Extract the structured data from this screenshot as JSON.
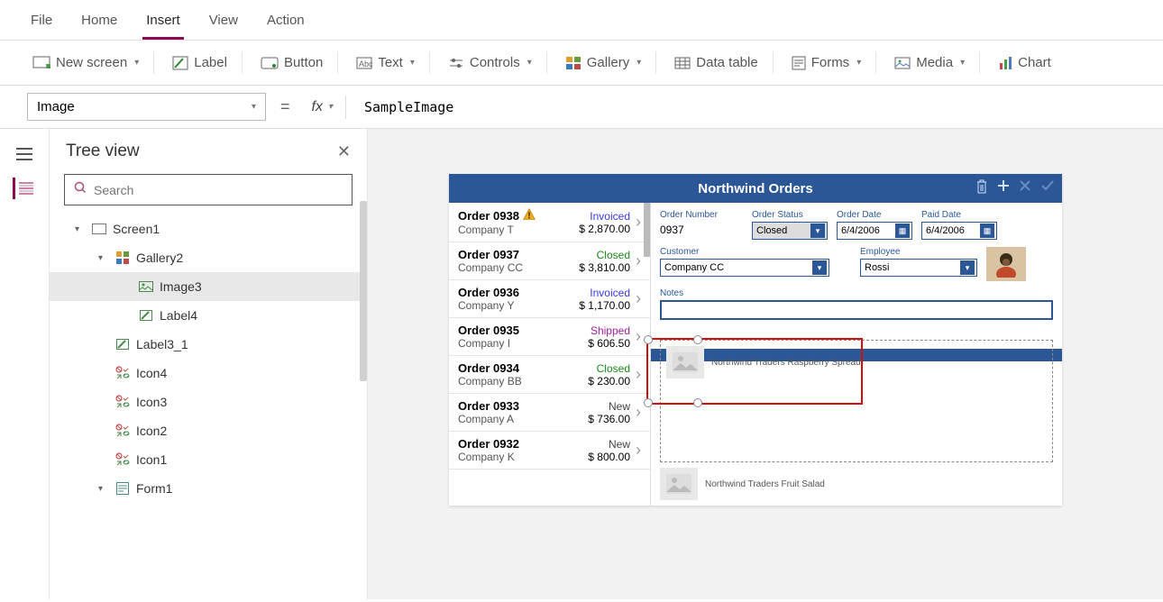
{
  "tabs": {
    "file": "File",
    "home": "Home",
    "insert": "Insert",
    "view": "View",
    "action": "Action",
    "active": "Insert"
  },
  "ribbon": {
    "new_screen": "New screen",
    "label": "Label",
    "button": "Button",
    "text": "Text",
    "controls": "Controls",
    "gallery": "Gallery",
    "data_table": "Data table",
    "forms": "Forms",
    "media": "Media",
    "chart": "Chart"
  },
  "formula": {
    "property": "Image",
    "value": "SampleImage"
  },
  "tree": {
    "title": "Tree view",
    "search_placeholder": "Search",
    "screen": "Screen1",
    "gallery": "Gallery2",
    "image": "Image3",
    "label4": "Label4",
    "label3_1": "Label3_1",
    "icon4": "Icon4",
    "icon3": "Icon3",
    "icon2": "Icon2",
    "icon1": "Icon1",
    "form1": "Form1"
  },
  "app": {
    "title": "Northwind Orders",
    "orders": [
      {
        "num": "Order 0938",
        "warn": true,
        "company": "Company T",
        "status": "Invoiced",
        "price": "$ 2,870.00"
      },
      {
        "num": "Order 0937",
        "company": "Company CC",
        "status": "Closed",
        "price": "$ 3,810.00"
      },
      {
        "num": "Order 0936",
        "company": "Company Y",
        "status": "Invoiced",
        "price": "$ 1,170.00"
      },
      {
        "num": "Order 0935",
        "company": "Company I",
        "status": "Shipped",
        "price": "$ 606.50"
      },
      {
        "num": "Order 0934",
        "company": "Company BB",
        "status": "Closed",
        "price": "$ 230.00"
      },
      {
        "num": "Order 0933",
        "company": "Company A",
        "status": "New",
        "price": "$ 736.00"
      },
      {
        "num": "Order 0932",
        "company": "Company K",
        "status": "New",
        "price": "$ 800.00"
      }
    ],
    "detail": {
      "order_number_label": "Order Number",
      "order_number": "0937",
      "order_status_label": "Order Status",
      "order_status": "Closed",
      "order_date_label": "Order Date",
      "order_date": "6/4/2006",
      "paid_date_label": "Paid Date",
      "paid_date": "6/4/2006",
      "customer_label": "Customer",
      "customer": "Company CC",
      "employee_label": "Employee",
      "employee": "Rossi",
      "notes_label": "Notes"
    },
    "gallery_item1": "Northwind Traders Raspberry Spread",
    "gallery_item2": "Northwind Traders Fruit Salad"
  }
}
